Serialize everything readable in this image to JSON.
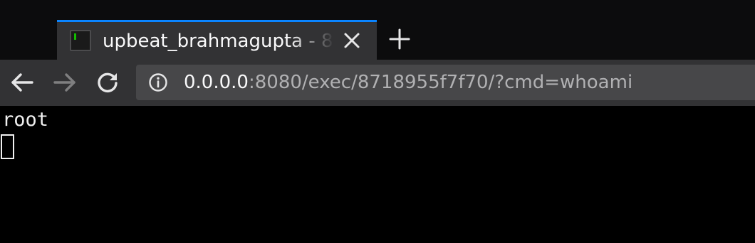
{
  "browser": {
    "tab": {
      "title": "upbeat_brahmagupta - 8",
      "favicon": "terminal-icon",
      "close_icon": "close-icon"
    },
    "new_tab_icon": "plus-icon",
    "nav": {
      "back_icon": "arrow-left-icon",
      "forward_icon": "arrow-right-icon",
      "reload_icon": "reload-icon"
    },
    "urlbar": {
      "info_icon": "info-icon",
      "host": "0.0.0.0",
      "path": ":8080/exec/8718955f7f70/?cmd=whoami"
    }
  },
  "terminal": {
    "output": "root"
  },
  "colors": {
    "tab_accent": "#0a84ff",
    "favicon_bar": "#12bc00",
    "toolbar_bg": "#323234",
    "urlbar_bg": "#474749",
    "content_bg": "#000000"
  }
}
